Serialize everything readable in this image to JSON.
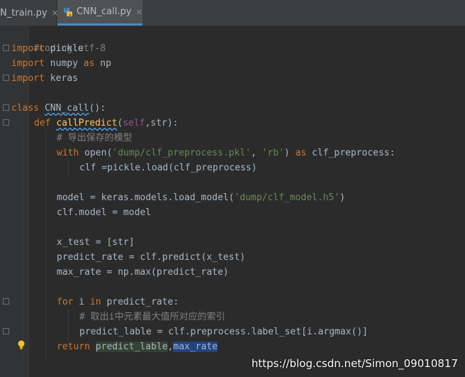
{
  "tabs": [
    {
      "label": "N_train.py",
      "close": "×",
      "active": false
    },
    {
      "label": "CNN_call.py",
      "close": "×",
      "active": true
    }
  ],
  "colors": {
    "background": "#2b2b2b",
    "keyword": "#cc7832",
    "string": "#6a8759",
    "comment": "#808080",
    "default_text": "#a9b7c6",
    "function_name": "#ffc66d",
    "self": "#94558d",
    "selection": "#214283",
    "tab_underline": "#4a88c7"
  },
  "code": {
    "l1": "#coding:utf-8",
    "l2_kw": "import",
    "l2_rest": " pickle",
    "l3_kw": "import",
    "l3_a": " numpy ",
    "l3_kw2": "as",
    "l3_b": " np",
    "l4_kw": "import",
    "l4_rest": " keras",
    "l6_kw": "class",
    "l6_sp": " ",
    "l6_name": "CNN_call",
    "l6_rest": "():",
    "l7_kw": "def",
    "l7_sp": " ",
    "l7_name": "callPredict",
    "l7_a": "(",
    "l7_self": "self",
    "l7_b": ",str):",
    "l8": "# 导出保存的模型",
    "l9_kw": "with",
    "l9_a": " open(",
    "l9_s1": "'dump/clf_preprocess.pkl'",
    "l9_b": ", ",
    "l9_s2": "'rb'",
    "l9_c": ") ",
    "l9_kw2": "as",
    "l9_d": " clf_preprocess:",
    "l10": "clf =pickle.load(clf_preprocess)",
    "l12_a": "model = keras.models.load_model(",
    "l12_s": "'dump/clf_model.h5'",
    "l12_b": ")",
    "l13": "clf.model = model",
    "l15": "x_test = [str]",
    "l16": "predict_rate = clf.predict(x_test)",
    "l17": "max_rate = np.max(predict_rate)",
    "l19_kw": "for",
    "l19_a": " i ",
    "l19_kw2": "in",
    "l19_b": " predict_rate:",
    "l20": "# 取出i中元素最大值所对应的索引",
    "l21": "predict_lable = clf.preprocess.label_set[i.argmax()]",
    "l22_kw": "return",
    "l22_sp": " ",
    "l22_a": "predict_lable",
    "l22_comma": ",",
    "l22_b": "max_rate"
  },
  "watermark": "https://blog.csdn.net/Simon_09010817"
}
